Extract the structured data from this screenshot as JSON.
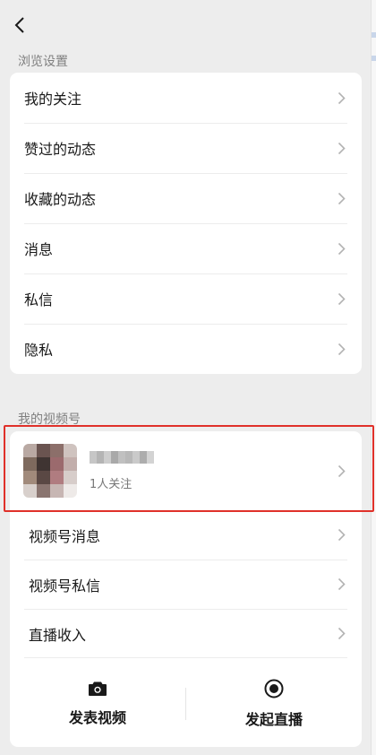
{
  "browse": {
    "title": "浏览设置",
    "items": [
      {
        "label": "我的关注"
      },
      {
        "label": "赞过的动态"
      },
      {
        "label": "收藏的动态"
      },
      {
        "label": "消息"
      },
      {
        "label": "私信"
      },
      {
        "label": "隐私"
      }
    ]
  },
  "channel": {
    "title": "我的视频号",
    "profile": {
      "followers": "1人关注"
    },
    "items": [
      {
        "label": "视频号消息"
      },
      {
        "label": "视频号私信"
      },
      {
        "label": "直播收入"
      }
    ],
    "actions": [
      {
        "label": "发表视频",
        "icon": "camera-icon"
      },
      {
        "label": "发起直播",
        "icon": "live-record-icon"
      }
    ]
  },
  "colors": {
    "background": "#ededed",
    "card": "#ffffff",
    "highlight": "#e0312a",
    "secondary_text": "#7f7f7f"
  }
}
